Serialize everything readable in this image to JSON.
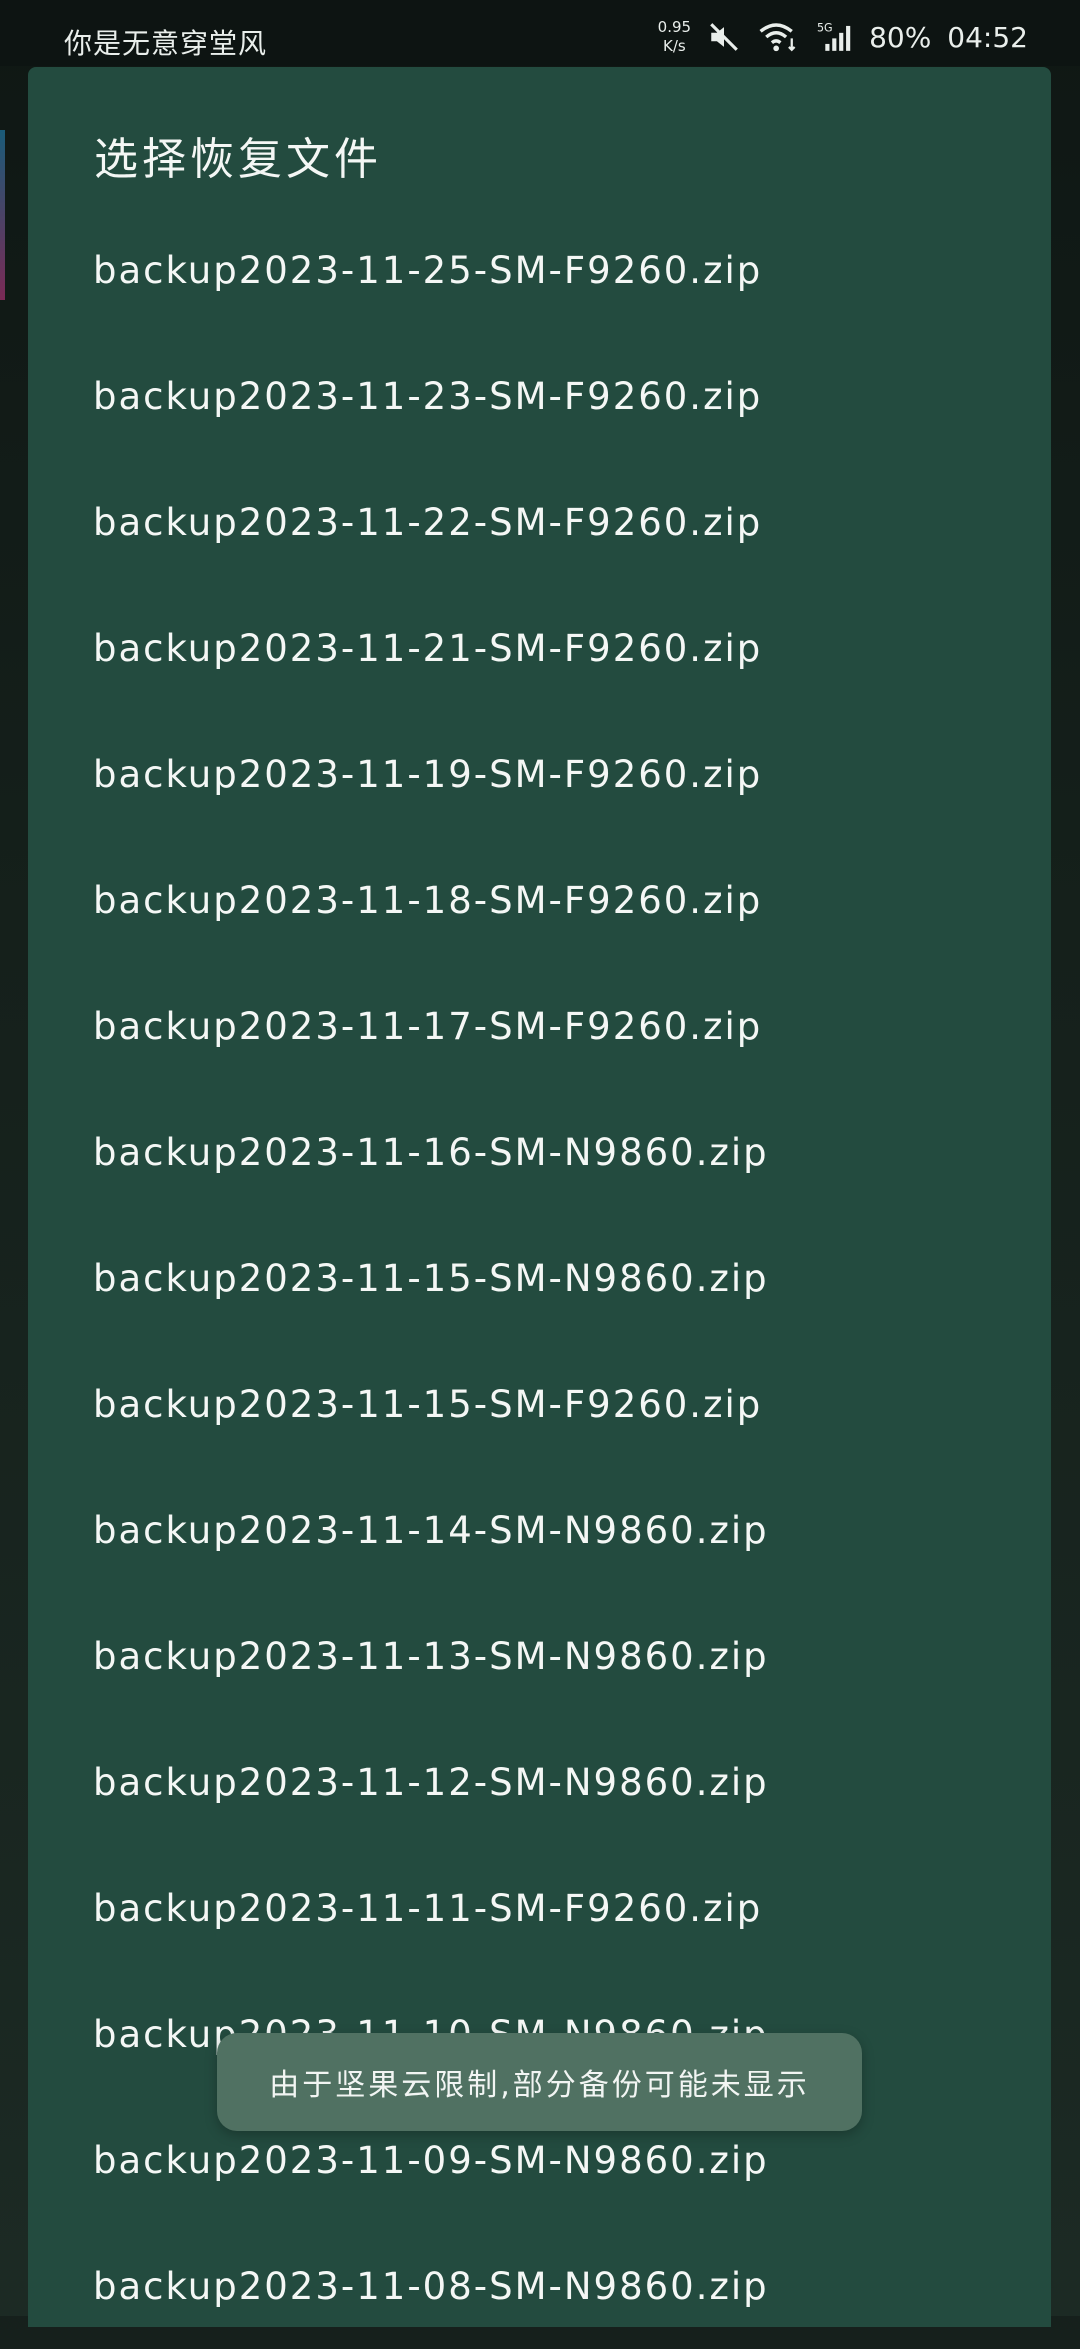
{
  "status_bar": {
    "carrier_text": "你是无意穿堂风",
    "net_speed_value": "0.95",
    "net_speed_unit": "K/s",
    "network_type": "5G",
    "battery": "80%",
    "time": "04:52",
    "icons": [
      "mute-icon",
      "wifi-icon",
      "signal-icon"
    ]
  },
  "dialog": {
    "title": "选择恢复文件",
    "files": [
      "backup2023-11-25-SM-F9260.zip",
      "backup2023-11-23-SM-F9260.zip",
      "backup2023-11-22-SM-F9260.zip",
      "backup2023-11-21-SM-F9260.zip",
      "backup2023-11-19-SM-F9260.zip",
      "backup2023-11-18-SM-F9260.zip",
      "backup2023-11-17-SM-F9260.zip",
      "backup2023-11-16-SM-N9860.zip",
      "backup2023-11-15-SM-N9860.zip",
      "backup2023-11-15-SM-F9260.zip",
      "backup2023-11-14-SM-N9860.zip",
      "backup2023-11-13-SM-N9860.zip",
      "backup2023-11-12-SM-N9860.zip",
      "backup2023-11-11-SM-F9260.zip",
      "backup2023-11-10-SM-N9860.zip",
      "backup2023-11-09-SM-N9860.zip",
      "backup2023-11-08-SM-N9860.zip"
    ]
  },
  "toast": {
    "message": "由于坚果云限制,部分备份可能未显示"
  },
  "colors": {
    "dialog_background": "#234b3f",
    "toast_background": "#507162",
    "text": "#f4f7f5"
  }
}
